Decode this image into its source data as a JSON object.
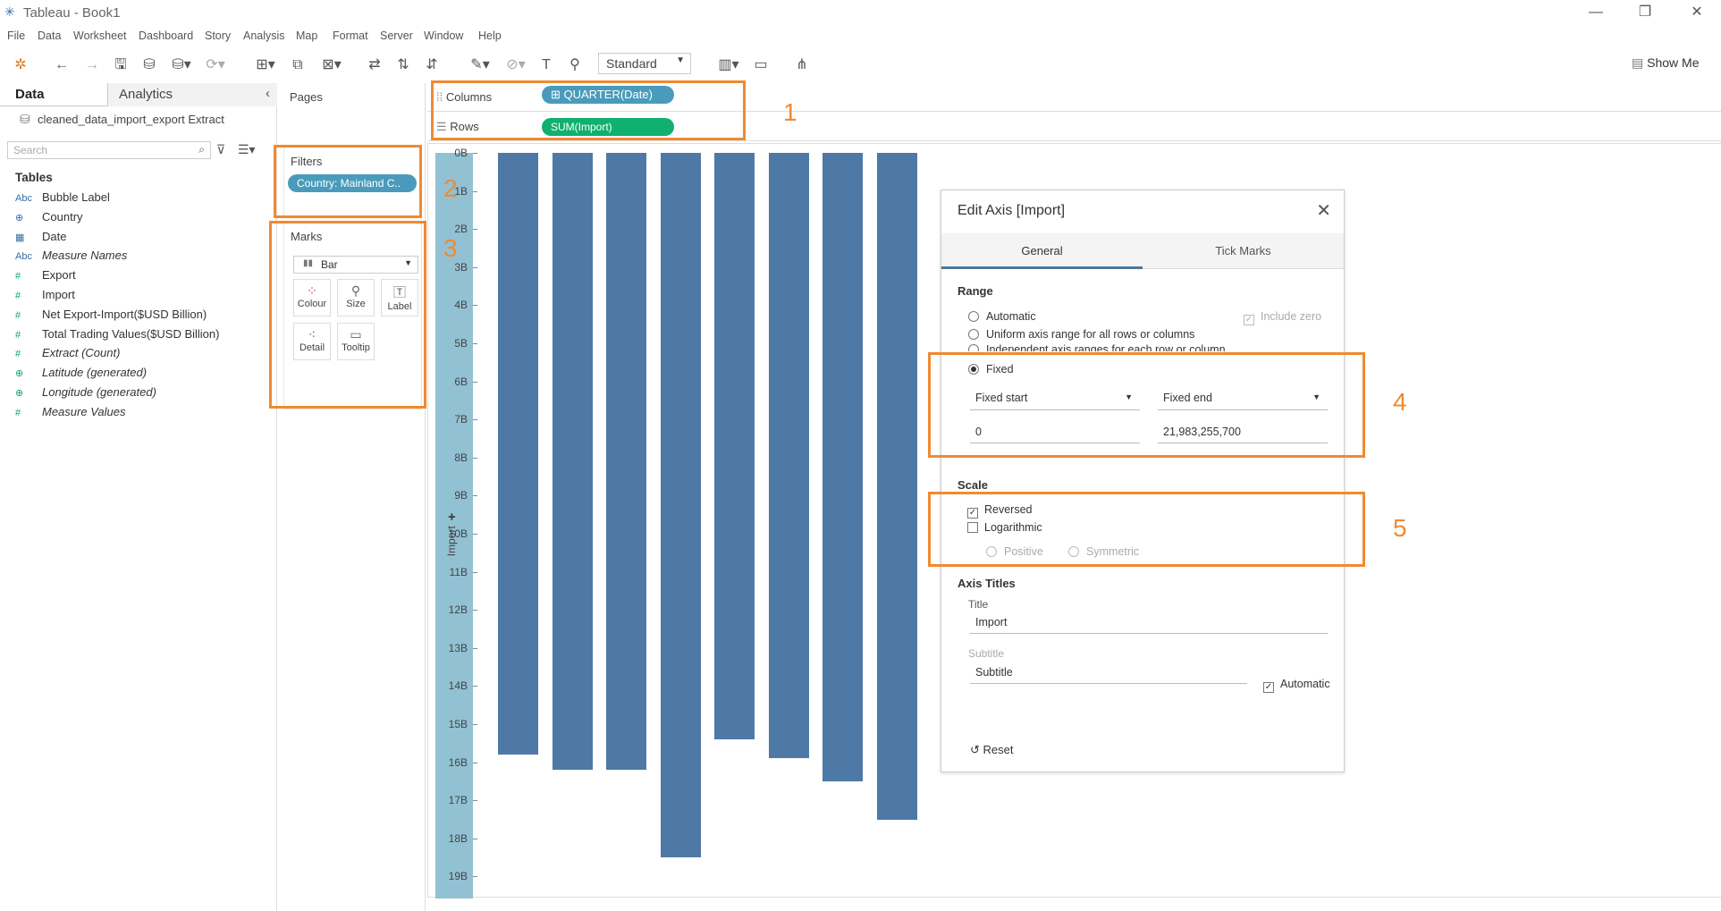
{
  "window": {
    "title": "Tableau - Book1"
  },
  "menu": [
    "File",
    "Data",
    "Worksheet",
    "Dashboard",
    "Story",
    "Analysis",
    "Map",
    "Format",
    "Server",
    "Window",
    "Help"
  ],
  "toolbar": {
    "fit": "Standard",
    "show_me": "Show Me"
  },
  "data_pane": {
    "tabs": [
      "Data",
      "Analytics"
    ],
    "source": "cleaned_data_import_export Extract",
    "search_placeholder": "Search",
    "tables_heading": "Tables",
    "fields": [
      {
        "icon": "Abc",
        "name": "Bubble Label",
        "kind": "dim"
      },
      {
        "icon": "⊕",
        "name": "Country",
        "kind": "dim"
      },
      {
        "icon": "▦",
        "name": "Date",
        "kind": "dim"
      },
      {
        "icon": "Abc",
        "name": "Measure Names",
        "kind": "dim",
        "italic": true
      },
      {
        "icon": "#",
        "name": "Export",
        "kind": "meas"
      },
      {
        "icon": "#",
        "name": "Import",
        "kind": "meas"
      },
      {
        "icon": "#",
        "name": "Net Export-Import($USD Billion)",
        "kind": "meas"
      },
      {
        "icon": "#",
        "name": "Total Trading Values($USD Billion)",
        "kind": "meas"
      },
      {
        "icon": "#",
        "name": "Extract (Count)",
        "kind": "meas",
        "italic": true
      },
      {
        "icon": "⊕",
        "name": "Latitude (generated)",
        "kind": "meas",
        "italic": true
      },
      {
        "icon": "⊕",
        "name": "Longitude (generated)",
        "kind": "meas",
        "italic": true
      },
      {
        "icon": "#",
        "name": "Measure Values",
        "kind": "meas",
        "italic": true
      }
    ]
  },
  "cards": {
    "pages": "Pages",
    "filters": "Filters",
    "filter_pill": "Country: Mainland C..",
    "marks": "Marks",
    "mark_type": "Bar",
    "mark_buttons": [
      "Colour",
      "Size",
      "Label",
      "Detail",
      "Tooltip"
    ]
  },
  "shelves": {
    "columns_label": "Columns",
    "columns_pill": "QUARTER(Date)",
    "rows_label": "Rows",
    "rows_pill": "SUM(Import)"
  },
  "chart_data": {
    "type": "bar",
    "ylabel": "Import",
    "y_reversed": true,
    "y_ticks": [
      "0B",
      "1B",
      "2B",
      "3B",
      "4B",
      "5B",
      "6B",
      "7B",
      "8B",
      "9B",
      "10B",
      "11B",
      "12B",
      "13B",
      "14B",
      "15B",
      "16B",
      "17B",
      "18B",
      "19B"
    ],
    "ylim": [
      0,
      19.3
    ],
    "series": [
      {
        "values": [
          15.8,
          16.2,
          16.2,
          18.5,
          15.4,
          15.9,
          16.5,
          17.5
        ]
      }
    ]
  },
  "dialog": {
    "title": "Edit Axis [Import]",
    "tabs": [
      "General",
      "Tick Marks"
    ],
    "range_heading": "Range",
    "range_options": [
      "Automatic",
      "Uniform axis range for all rows or columns",
      "Independent axis ranges for each row or column",
      "Fixed"
    ],
    "include_zero": "Include zero",
    "fixed_start": "Fixed start",
    "fixed_end": "Fixed end",
    "start_value": "0",
    "end_value": "21,983,255,700",
    "scale_heading": "Scale",
    "reversed": "Reversed",
    "logarithmic": "Logarithmic",
    "positive": "Positive",
    "symmetric": "Symmetric",
    "axis_titles_heading": "Axis Titles",
    "title_label": "Title",
    "title_value": "Import",
    "subtitle_label": "Subtitle",
    "subtitle_placeholder": "Subtitle",
    "automatic": "Automatic",
    "reset": "Reset"
  },
  "annotations": [
    "1",
    "2",
    "3",
    "4",
    "5"
  ],
  "colors": {
    "accent_orange": "#f08a30",
    "bar": "#4e79a7",
    "axis_band": "#92c1d3",
    "pill_blue": "#4a9bbb",
    "pill_green": "#10b070"
  }
}
